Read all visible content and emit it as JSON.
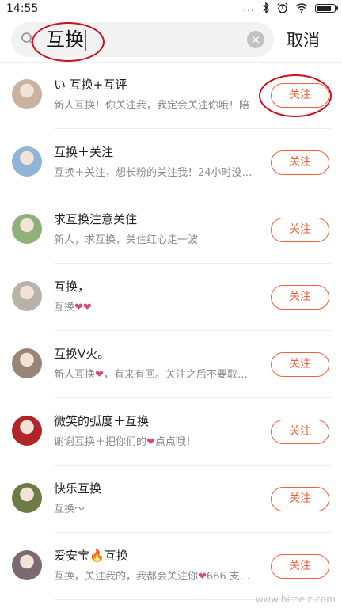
{
  "status_bar": {
    "time": "14:55",
    "signal": "...",
    "battery_level": 0.85
  },
  "search": {
    "query": "互换",
    "cancel_label": "取消",
    "clear_glyph": "×"
  },
  "results": [
    {
      "name": "い 互换+互评",
      "desc": "新人互换！你关注我，我定会关注你哦！陪",
      "button": "关注",
      "avatar_color": "#c9b29f"
    },
    {
      "name": "互换＋关注",
      "desc": "互换＋关注，想长粉的关注我！24小时没…",
      "button": "关注",
      "avatar_color": "#8fb4d6"
    },
    {
      "name": "求互换注意关住",
      "desc": "新人，求互换，关住红心走一波",
      "button": "关注",
      "avatar_color": "#8fb07a"
    },
    {
      "name": "互换，",
      "desc_text": "互换",
      "desc_hearts": "❤❤",
      "button": "关注",
      "avatar_color": "#b8b3a6"
    },
    {
      "name": "互换V火。",
      "desc_text": "新人互换",
      "desc_hearts": "❤",
      "desc_text2": "，有来有回。关注之后不要取…",
      "button": "关注",
      "avatar_color": "#9a8574"
    },
    {
      "name": "微笑的弧度＋互换",
      "desc_text": "谢谢互换＋把你们的",
      "desc_hearts": "❤",
      "desc_text2": "点点哦！",
      "button": "关注",
      "avatar_color": "#b1242a"
    },
    {
      "name": "快乐互换",
      "desc": "互换～",
      "button": "关注",
      "avatar_color": "#6f7a46"
    },
    {
      "name_text": "爱安宝",
      "name_fire": "🔥",
      "name_text2": "互换",
      "desc_text": "互换，关注我的，我都会关注你",
      "desc_hearts": "❤",
      "desc_text2": "666 支…",
      "button": "关注",
      "avatar_color": "#7b6a6f"
    }
  ],
  "watermark": "www.bimeiz.com",
  "colors": {
    "accent": "#f0613b",
    "heart": "#e0457b",
    "annotation": "#d0101a"
  },
  "icons": [
    "search-icon",
    "clear-icon",
    "bluetooth-icon",
    "alarm-icon",
    "wifi-icon",
    "battery-icon"
  ]
}
